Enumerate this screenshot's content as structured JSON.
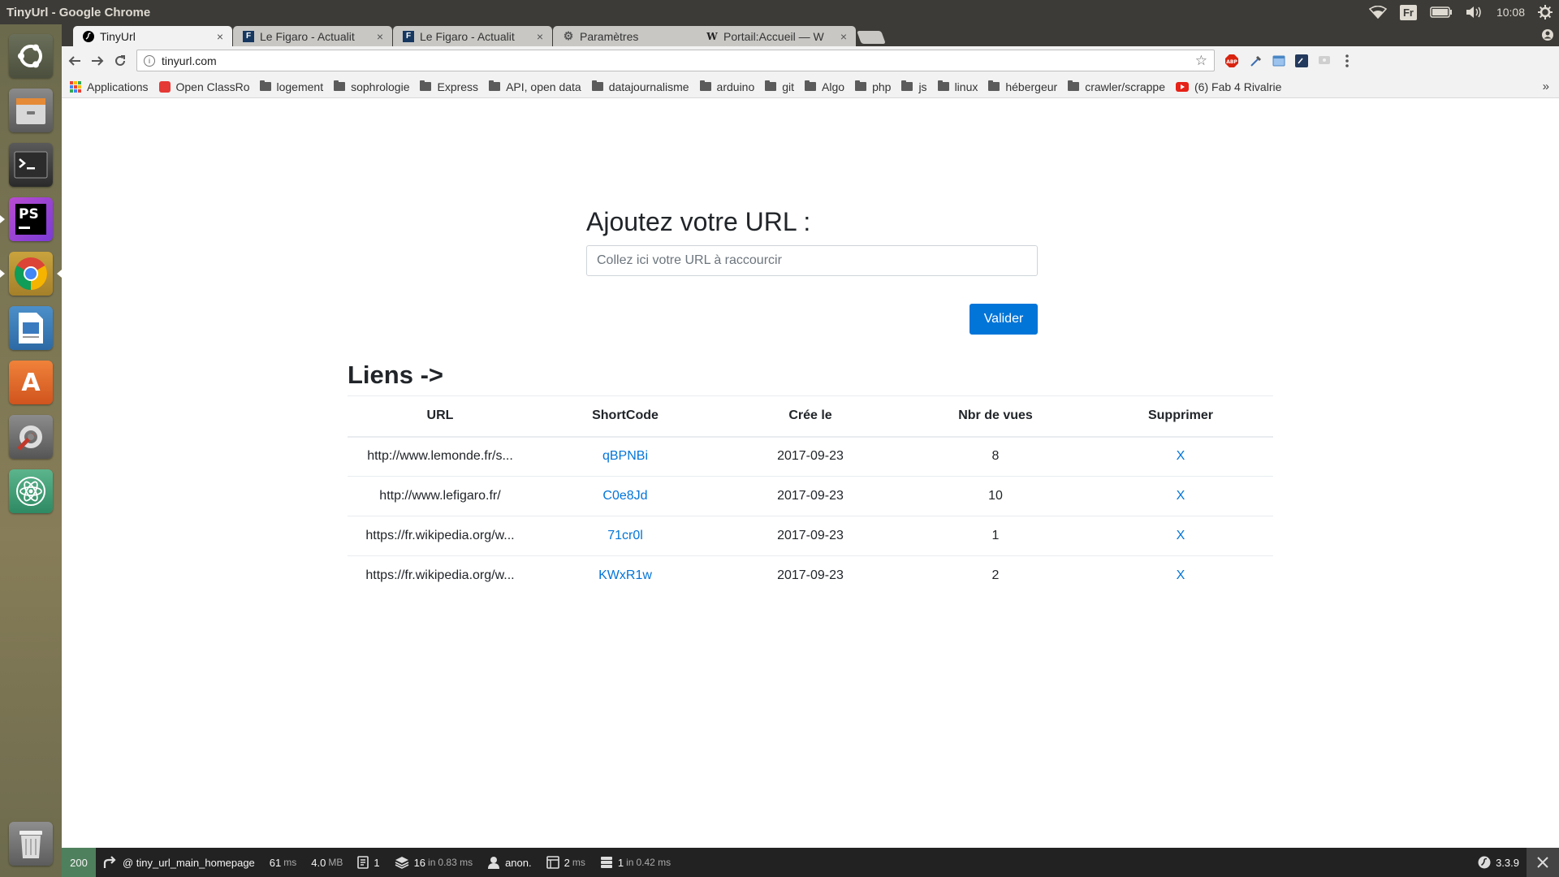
{
  "desktop": {
    "window_title": "TinyUrl - Google Chrome",
    "keyboard_layout": "Fr",
    "clock": "10:08",
    "launcher": [
      {
        "name": "ubuntu-dash-icon"
      },
      {
        "name": "files-icon"
      },
      {
        "name": "terminal-icon"
      },
      {
        "name": "phpstorm-icon",
        "text": "PS"
      },
      {
        "name": "chrome-icon"
      },
      {
        "name": "writer-icon"
      },
      {
        "name": "software-center-icon",
        "text": "A"
      },
      {
        "name": "settings-icon"
      },
      {
        "name": "atom-icon"
      },
      {
        "name": "trash-icon"
      }
    ]
  },
  "browser": {
    "tabs": [
      {
        "label": "TinyUrl",
        "favicon": "symfony",
        "active": true
      },
      {
        "label": "Le Figaro - Actualit",
        "favicon": "F"
      },
      {
        "label": "Le Figaro - Actualit",
        "favicon": "F"
      },
      {
        "label": "Paramètres",
        "favicon": "gear"
      },
      {
        "label": "Portail:Accueil — W",
        "favicon": "W"
      }
    ],
    "address": "tinyurl.com",
    "bookmarks": [
      {
        "label": "Applications",
        "icon": "apps"
      },
      {
        "label": "Open ClassRoom",
        "icon": "oc"
      },
      {
        "label": "logement",
        "icon": "folder"
      },
      {
        "label": "sophrologie",
        "icon": "folder"
      },
      {
        "label": "Express",
        "icon": "folder"
      },
      {
        "label": "API, open data",
        "icon": "folder"
      },
      {
        "label": "datajournalisme",
        "icon": "folder"
      },
      {
        "label": "arduino",
        "icon": "folder"
      },
      {
        "label": "git",
        "icon": "folder"
      },
      {
        "label": "Algo",
        "icon": "folder"
      },
      {
        "label": "php",
        "icon": "folder"
      },
      {
        "label": "js",
        "icon": "folder"
      },
      {
        "label": "linux",
        "icon": "folder"
      },
      {
        "label": "hébergeur",
        "icon": "folder"
      },
      {
        "label": "crawler/scrappe",
        "icon": "folder"
      },
      {
        "label": "(6) Fab 4 Rivalrie",
        "icon": "youtube"
      }
    ],
    "bookmarks_overflow": "»"
  },
  "page": {
    "form": {
      "title": "Ajoutez votre URL :",
      "placeholder": "Collez ici votre URL à raccourcir",
      "submit_label": "Valider"
    },
    "links": {
      "title": "Liens ->",
      "headers": [
        "URL",
        "ShortCode",
        "Crée le",
        "Nbr de vues",
        "Supprimer"
      ],
      "rows": [
        {
          "url": "http://www.lemonde.fr/s...",
          "shortcode": "qBPNBi",
          "created": "2017-09-23",
          "views": "8",
          "delete": "X"
        },
        {
          "url": "http://www.lefigaro.fr/",
          "shortcode": "C0e8Jd",
          "created": "2017-09-23",
          "views": "10",
          "delete": "X"
        },
        {
          "url": "https://fr.wikipedia.org/w...",
          "shortcode": "71cr0l",
          "created": "2017-09-23",
          "views": "1",
          "delete": "X"
        },
        {
          "url": "https://fr.wikipedia.org/w...",
          "shortcode": "KWxR1w",
          "created": "2017-09-23",
          "views": "2",
          "delete": "X"
        }
      ]
    }
  },
  "debug_toolbar": {
    "status": "200",
    "route": "@ tiny_url_main_homepage",
    "time_value": "61",
    "time_unit": "ms",
    "memory_value": "4.0",
    "memory_unit": "MB",
    "forms": "1",
    "db_queries": "16",
    "db_in": "in",
    "db_time": "0.83 ms",
    "user": "anon.",
    "twig_value": "2",
    "twig_unit": "ms",
    "cache_value": "1",
    "cache_in": "in",
    "cache_time": "0.42 ms",
    "symfony_version": "3.3.9"
  },
  "colors": {
    "primary": "#0275d8",
    "panel": "#3c3b37",
    "debug_bg": "#222222",
    "status_ok": "#4f805d"
  }
}
